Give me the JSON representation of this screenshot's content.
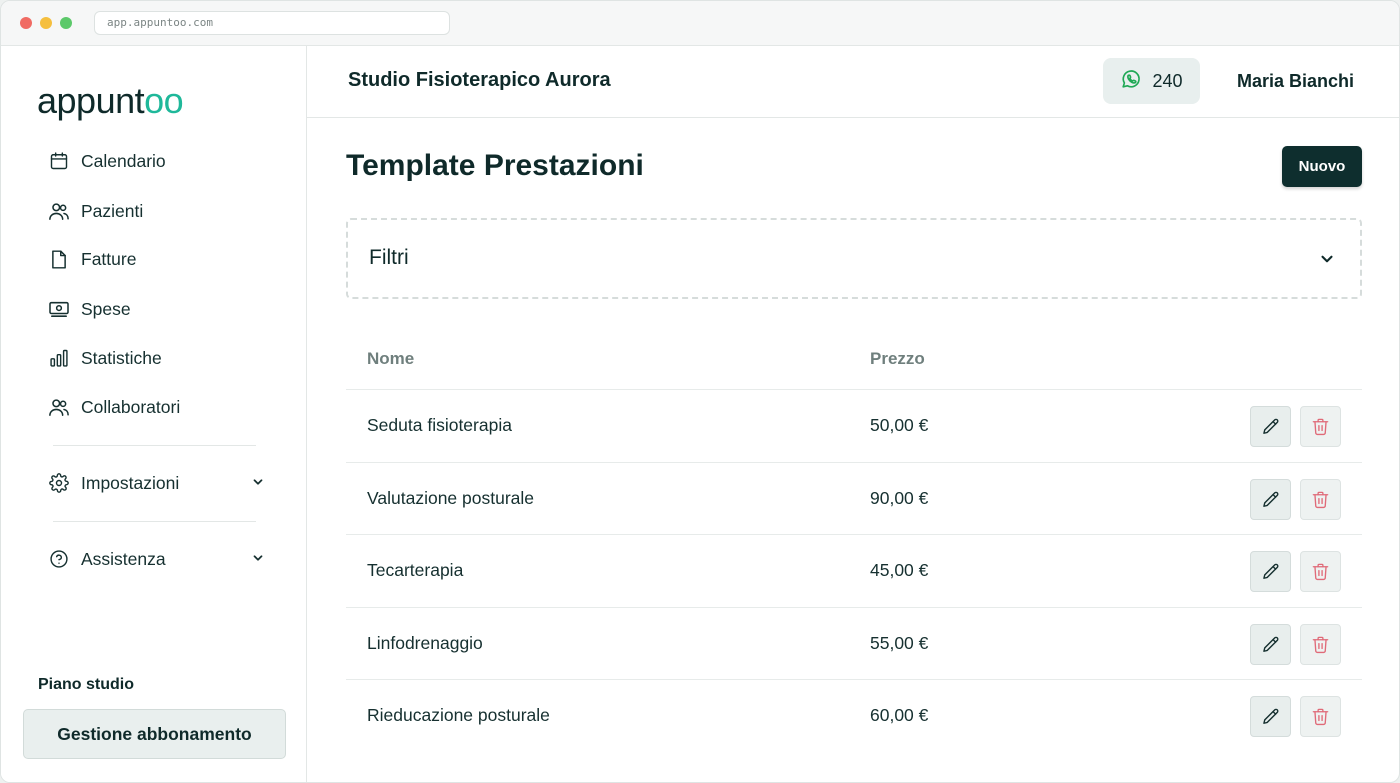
{
  "browser": {
    "url": "app.appuntoo.com"
  },
  "sidebar": {
    "logo": {
      "prefix": "appunt",
      "suffix": "oo"
    },
    "items": [
      {
        "label": "Calendario",
        "icon": "calendar-icon"
      },
      {
        "label": "Pazienti",
        "icon": "users-icon"
      },
      {
        "label": "Fatture",
        "icon": "file-icon"
      },
      {
        "label": "Spese",
        "icon": "banknote-icon"
      },
      {
        "label": "Statistiche",
        "icon": "bar-chart-icon"
      },
      {
        "label": "Collaboratori",
        "icon": "users-icon"
      }
    ],
    "settings": {
      "label": "Impostazioni",
      "icon": "gear-icon"
    },
    "help": {
      "label": "Assistenza",
      "icon": "help-circle-icon"
    },
    "plan_label": "Piano studio",
    "plan_button": "Gestione abbonamento"
  },
  "header": {
    "studio_name": "Studio Fisioterapico Aurora",
    "whatsapp_count": "240",
    "user_name": "Maria Bianchi"
  },
  "main": {
    "title": "Template Prestazioni",
    "new_button": "Nuovo",
    "filters_label": "Filtri",
    "table": {
      "columns": [
        "Nome",
        "Prezzo"
      ],
      "rows": [
        {
          "name": "Seduta fisioterapia",
          "price": "50,00 €"
        },
        {
          "name": "Valutazione posturale",
          "price": "90,00 €"
        },
        {
          "name": "Tecarterapia",
          "price": "45,00 €"
        },
        {
          "name": "Linfodrenaggio",
          "price": "55,00 €"
        },
        {
          "name": "Rieducazione posturale",
          "price": "60,00 €"
        }
      ]
    }
  },
  "colors": {
    "brand_dark": "#0e2e2e",
    "accent": "#1fb89a",
    "whatsapp": "#1fa855",
    "delete": "#e06a78"
  }
}
